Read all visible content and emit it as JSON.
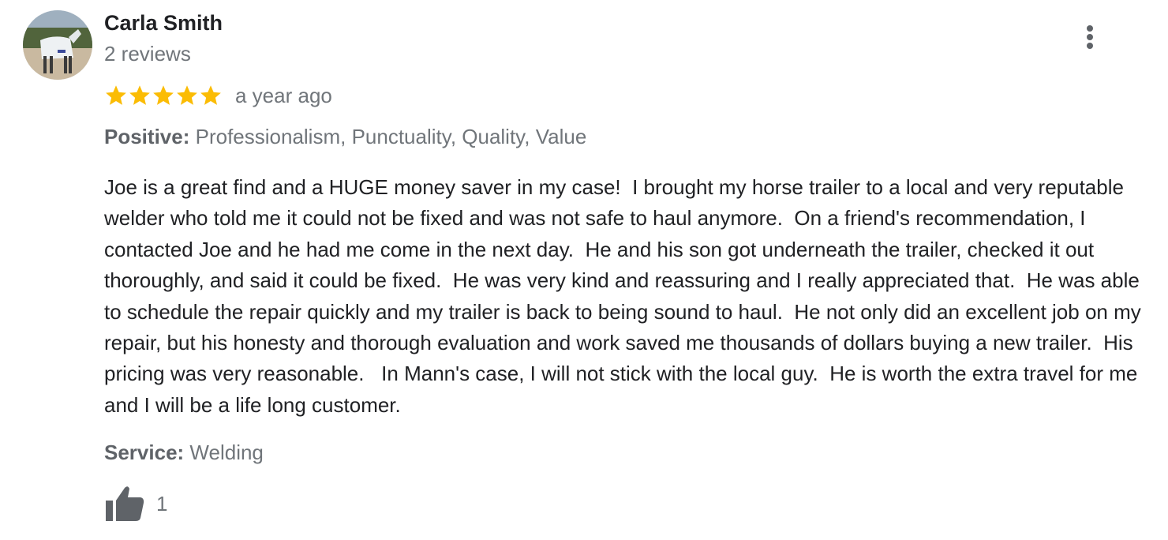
{
  "review": {
    "reviewer_name": "Carla Smith",
    "review_count": "2 reviews",
    "rating": 5,
    "rating_max": 5,
    "star_color": "#fbbc04",
    "date": "a year ago",
    "positive_label": "Positive:",
    "positive_value": "Professionalism, Punctuality, Quality, Value",
    "text": "Joe is a great find and a HUGE money saver in my case!  I brought my horse trailer to a local and very reputable welder who told me it could not be fixed and was not safe to haul anymore.  On a friend's recommendation, I contacted Joe and he had me come in the next day.  He and his son got underneath the trailer, checked it out thoroughly, and said it could be fixed.  He was very kind and reassuring and I really appreciated that.  He was able to schedule the repair quickly and my trailer is back to being sound to haul.  He not only did an excellent job on my repair, but his honesty and thorough evaluation and work saved me thousands of dollars buying a new trailer.  His pricing was very reasonable.   In Mann's case, I will not stick with the local guy.  He is worth the extra travel for me and I will be a life long customer.",
    "service_label": "Service:",
    "service_value": "Welding",
    "like_count": "1"
  },
  "icons": {
    "more": "more-vert-icon",
    "like": "thumb-up-icon",
    "star": "star-icon"
  }
}
